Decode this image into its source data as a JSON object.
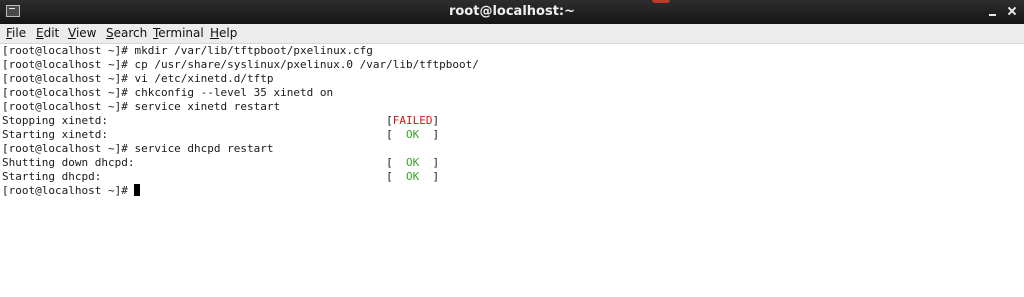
{
  "window": {
    "title": "root@localhost:~"
  },
  "menu": {
    "items": [
      {
        "pre": "",
        "mnemonic": "F",
        "rest": "ile"
      },
      {
        "pre": "",
        "mnemonic": "E",
        "rest": "dit"
      },
      {
        "pre": "",
        "mnemonic": "V",
        "rest": "iew"
      },
      {
        "pre": "",
        "mnemonic": "S",
        "rest": "earch"
      },
      {
        "pre": "",
        "mnemonic": "T",
        "rest": "erminal"
      },
      {
        "pre": "",
        "mnemonic": "H",
        "rest": "elp"
      }
    ]
  },
  "terminal": {
    "lines": [
      "[root@localhost ~]# mkdir /var/lib/tftpboot/pxelinux.cfg",
      "[root@localhost ~]# cp /usr/share/syslinux/pxelinux.0 /var/lib/tftpboot/",
      "[root@localhost ~]# vi /etc/xinetd.d/tftp",
      "[root@localhost ~]# chkconfig --level 35 xinetd on",
      "[root@localhost ~]# service xinetd restart",
      "Stopping xinetd:                                          ",
      "Starting xinetd:                                          ",
      "[root@localhost ~]# service dhcpd restart",
      "Shutting down dhcpd:                                      ",
      "Starting dhcpd:                                           ",
      "[root@localhost ~]# "
    ],
    "status_failed": "FAILED",
    "status_ok": "  OK  ",
    "bracket_open": "[",
    "bracket_close": "]"
  },
  "colors": {
    "failed": "#d01818",
    "ok": "#3aa52a"
  },
  "icons": {
    "window_icon": "terminal-icon",
    "minimize": "minimize-icon",
    "close": "close-icon"
  }
}
